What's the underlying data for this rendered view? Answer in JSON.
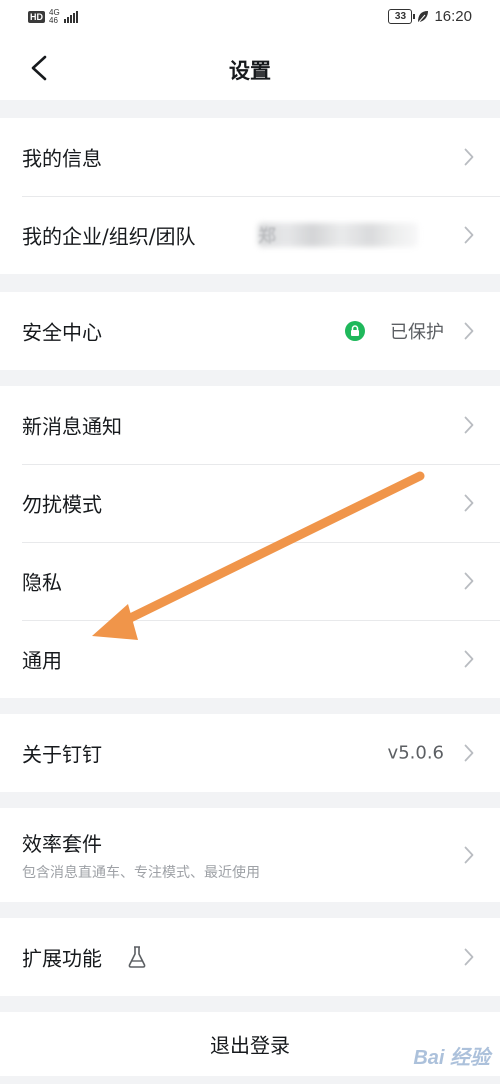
{
  "status_bar": {
    "left_badge": "HD",
    "network_top": "4G",
    "network_bottom": "46",
    "battery": "33",
    "time": "16:20"
  },
  "header": {
    "title": "设置"
  },
  "groups": {
    "profile": {
      "my_info": "我的信息",
      "my_org": "我的企业/组织/团队",
      "my_org_value": "郑"
    },
    "security": {
      "label": "安全中心",
      "status": "已保护"
    },
    "preferences": {
      "notifications": "新消息通知",
      "dnd": "勿扰模式",
      "privacy": "隐私",
      "general": "通用"
    },
    "about": {
      "label": "关于钉钉",
      "version": "v5.0.6"
    },
    "efficiency": {
      "label": "效率套件",
      "subtitle": "包含消息直通车、专注模式、最近使用"
    },
    "extensions": {
      "label": "扩展功能"
    },
    "logout": {
      "label": "退出登录"
    }
  },
  "watermark": {
    "text": "Bai 经验"
  },
  "colors": {
    "background": "#f2f3f5",
    "card": "#ffffff",
    "text": "#171a1d",
    "secondary": "#9ea1a6",
    "secure_green": "#1fb85b",
    "annotation_arrow": "#f0954a"
  },
  "icons": {
    "back": "chevron-left-icon",
    "row_arrow": "chevron-right-icon",
    "security_status": "shield-check-icon",
    "extensions": "flask-icon"
  }
}
